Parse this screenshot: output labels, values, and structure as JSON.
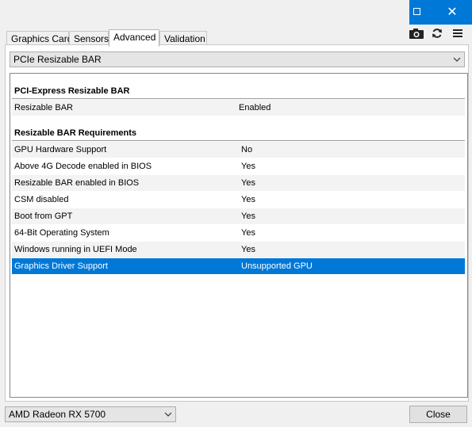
{
  "tabs": [
    "Graphics Card",
    "Sensors",
    "Advanced",
    "Validation"
  ],
  "active_tab": "Advanced",
  "toolbar": {
    "icons": [
      "camera-icon",
      "refresh-icon",
      "menu-icon"
    ]
  },
  "category_select": {
    "value": "PCIe Resizable BAR"
  },
  "sections": {
    "pcie": "PCI-Express Resizable BAR",
    "req": "Resizable BAR Requirements"
  },
  "rows": {
    "resizable_bar": {
      "label": "Resizable BAR",
      "value": "Enabled"
    },
    "gpu_hw": {
      "label": "GPU Hardware Support",
      "value": "No"
    },
    "above4g": {
      "label": "Above 4G Decode enabled in BIOS",
      "value": "Yes"
    },
    "rebar_bios": {
      "label": "Resizable BAR enabled in BIOS",
      "value": "Yes"
    },
    "csm": {
      "label": "CSM disabled",
      "value": "Yes"
    },
    "gpt": {
      "label": "Boot from GPT",
      "value": "Yes"
    },
    "os64": {
      "label": "64-Bit Operating System",
      "value": "Yes"
    },
    "uefi": {
      "label": "Windows running in UEFI Mode",
      "value": "Yes"
    },
    "driver": {
      "label": "Graphics Driver Support",
      "value": "Unsupported GPU"
    }
  },
  "gpu_select": {
    "value": "AMD Radeon RX 5700"
  },
  "close_label": "Close",
  "colors": {
    "accent": "#0078d7",
    "alt_row": "#f3f3f3"
  }
}
